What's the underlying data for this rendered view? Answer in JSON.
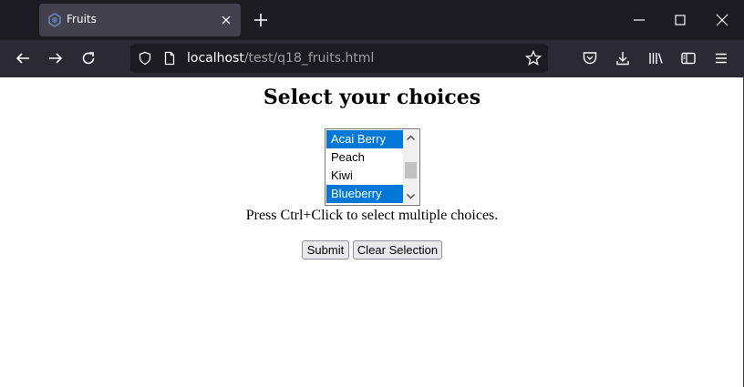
{
  "browser": {
    "tab": {
      "title": "Fruits",
      "favicon": "webpage-favicon-icon"
    },
    "url": {
      "host": "localhost",
      "path": "/test/q18_fruits.html"
    },
    "window_controls": [
      "minimize-icon",
      "maximize-icon",
      "close-icon"
    ],
    "toolbar_icons": [
      "pocket-icon",
      "download-icon",
      "library-icon",
      "sidebar-icon",
      "menu-icon"
    ]
  },
  "page": {
    "heading": "Select your choices",
    "listbox": {
      "options": [
        {
          "label": "Acai Berry",
          "selected": true
        },
        {
          "label": "Peach",
          "selected": false
        },
        {
          "label": "Kiwi",
          "selected": false
        },
        {
          "label": "Blueberry",
          "selected": true
        }
      ],
      "selection_color": "#0078d7"
    },
    "hint": "Press Ctrl+Click to select multiple choices.",
    "buttons": {
      "submit": "Submit",
      "clear": "Clear Selection"
    }
  }
}
